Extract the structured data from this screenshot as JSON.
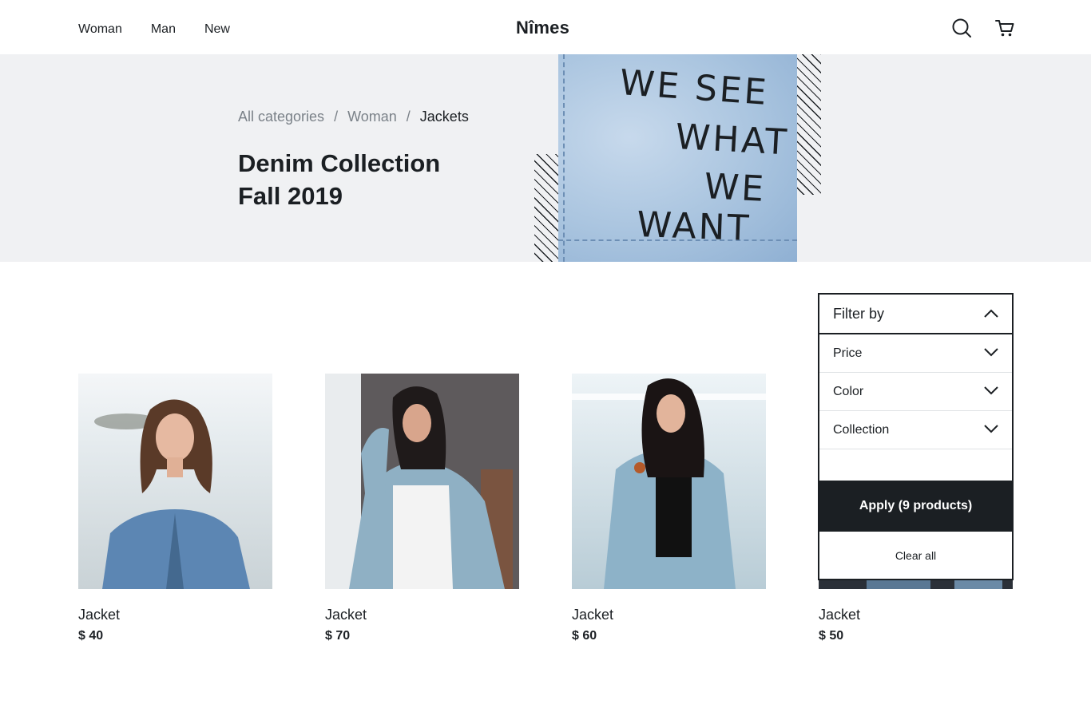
{
  "header": {
    "nav": [
      "Woman",
      "Man",
      "New"
    ],
    "logo": "Nîmes",
    "icons": [
      "search-icon",
      "cart-icon"
    ]
  },
  "hero": {
    "breadcrumbs": [
      "All categories",
      "Woman",
      "Jackets"
    ],
    "separator": "/",
    "title_line1": "Denim Collection",
    "title_line2": "Fall 2019",
    "image_text": [
      "WE SEE",
      "WHAT",
      "WE",
      "WANT"
    ]
  },
  "products": [
    {
      "name": "Jacket",
      "price": "$ 40"
    },
    {
      "name": "Jacket",
      "price": "$ 70"
    },
    {
      "name": "Jacket",
      "price": "$ 60"
    },
    {
      "name": "Jacket",
      "price": "$ 50"
    }
  ],
  "filter": {
    "title": "Filter by",
    "options": [
      "Price",
      "Color",
      "Collection"
    ],
    "apply_label": "Apply (9 products)",
    "clear_label": "Clear all"
  },
  "colors": {
    "ink": "#1b1f23",
    "hero_bg": "#f0f1f3",
    "muted": "#7a8188"
  }
}
